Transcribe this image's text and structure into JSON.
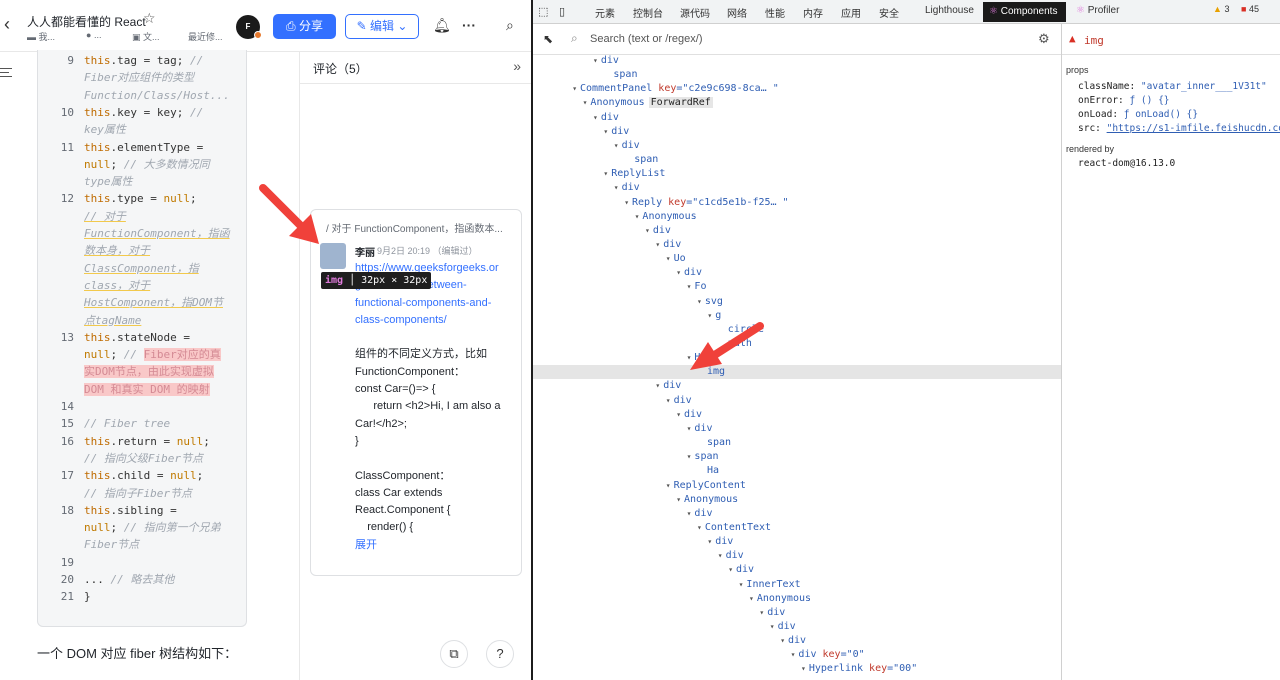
{
  "doc": {
    "title": "人人都能看懂的 React",
    "meta": [
      "我...",
      "...",
      "文...",
      "最近修..."
    ],
    "avatar_initials": "F",
    "share_label": "分享",
    "edit_label": "编辑",
    "code_lines": [
      {
        "n": "9",
        "html": "<span class='kw'>this</span>.tag = tag; <span class='cm'>//</span>"
      },
      {
        "n": "",
        "html": "<span class='cm'>Fiber对应组件的类型</span>"
      },
      {
        "n": "",
        "html": "<span class='cm'>Function/Class/Host...</span>"
      },
      {
        "n": "10",
        "html": "<span class='kw'>this</span>.key = key; <span class='cm'>//</span>"
      },
      {
        "n": "",
        "html": "<span class='cm'>key属性</span>"
      },
      {
        "n": "11",
        "html": "<span class='kw'>this</span>.elementType ="
      },
      {
        "n": "",
        "html": "<span class='kw2'>null</span>; <span class='cm'>// 大多数情况同</span>"
      },
      {
        "n": "",
        "html": "<span class='cm'>type属性</span>"
      },
      {
        "n": "12",
        "html": "<span class='kw'>this</span>.type = <span class='kw2'>null</span>;"
      },
      {
        "n": "",
        "html": "<span class='cm ul'>// 对于</span>"
      },
      {
        "n": "",
        "html": "<span class='cm ul'>FunctionComponent，指函</span>"
      },
      {
        "n": "",
        "html": "<span class='cm ul'>数本身，对于</span>"
      },
      {
        "n": "",
        "html": "<span class='cm ul'>ClassComponent，指</span>"
      },
      {
        "n": "",
        "html": "<span class='cm ul'>class，对于</span>"
      },
      {
        "n": "",
        "html": "<span class='cm ul'>HostComponent，指DOM节</span>"
      },
      {
        "n": "",
        "html": "<span class='cm ul'>点tagName</span>"
      },
      {
        "n": "13",
        "html": "<span class='kw'>this</span>.stateNode ="
      },
      {
        "n": "",
        "html": "<span class='kw2'>null</span>; <span class='cm'>//</span> <span class='hl'>Fiber对应的真</span>"
      },
      {
        "n": "",
        "html": "<span class='hl'>实DOM节点，由此实现虚拟</span>"
      },
      {
        "n": "",
        "html": "<span class='hl'>DOM 和真实 DOM 的映射</span>"
      },
      {
        "n": "14",
        "html": ""
      },
      {
        "n": "15",
        "html": "  <span class='cm'>// Fiber tree</span>"
      },
      {
        "n": "16",
        "html": "<span class='kw'>this</span>.return = <span class='kw2'>null</span>;"
      },
      {
        "n": "",
        "html": "<span class='cm'>// 指向父级Fiber节点</span>"
      },
      {
        "n": "17",
        "html": "<span class='kw'>this</span>.child = <span class='kw2'>null</span>;"
      },
      {
        "n": "",
        "html": "<span class='cm'>// 指向子Fiber节点</span>"
      },
      {
        "n": "18",
        "html": "<span class='kw'>this</span>.sibling ="
      },
      {
        "n": "",
        "html": "<span class='kw2'>null</span>;  <span class='cm'>// 指向第一个兄弟</span>"
      },
      {
        "n": "",
        "html": "<span class='cm'>Fiber节点</span>"
      },
      {
        "n": "19",
        "html": ""
      },
      {
        "n": "20",
        "html": "... <span class='cm'>// 略去其他</span>"
      },
      {
        "n": "21",
        "html": "}"
      }
    ],
    "bottom_text": "一个 DOM 对应 fiber 树结构如下："
  },
  "comments": {
    "title": "评论（5）",
    "quote": "/ 对于 FunctionComponent，指函数本...",
    "author": "李丽",
    "time": "9月2日 20:19 （编辑过）",
    "link": "https://www.geeksforgeeks.org/differences-between-functional-components-and-class-components/",
    "link_display": [
      "https://www.geeksforgeeks.or",
      "g/differences-between-",
      "functional-components-and-",
      "class-components/"
    ],
    "body": [
      "",
      "组件的不同定义方式，比如",
      "FunctionComponent：",
      "const Car=()=> {",
      "      return <h2>Hi, I am also a",
      "Car!</h2>;",
      "}",
      "",
      "ClassComponent：",
      "class Car extends",
      "React.Component {",
      "    render() {"
    ],
    "more": "展开"
  },
  "tooltip": {
    "tag": "img",
    "size": "32px × 32px"
  },
  "devtools": {
    "tabs": [
      "元素",
      "控制台",
      "源代码",
      "网络",
      "性能",
      "内存",
      "应用",
      "安全",
      "Lighthouse"
    ],
    "active_tab": "Components",
    "profiler_tab": "Profiler",
    "warnings": "3",
    "errors": "45",
    "search_placeholder": "Search (text or /regex/)",
    "selected_component": "img",
    "tree": [
      {
        "indent": 5,
        "arrow": "▾",
        "name": "div"
      },
      {
        "indent": 6,
        "arrow": "",
        "name": "span"
      },
      {
        "indent": 3,
        "arrow": "▾",
        "name": "CommentPanel",
        "key": "\"c2e9c698-8ca… \""
      },
      {
        "indent": 4,
        "arrow": "▾",
        "name": "Anonymous",
        "fwd": "ForwardRef"
      },
      {
        "indent": 5,
        "arrow": "▾",
        "name": "div"
      },
      {
        "indent": 6,
        "arrow": "▾",
        "name": "div"
      },
      {
        "indent": 7,
        "arrow": "▾",
        "name": "div"
      },
      {
        "indent": 8,
        "arrow": "",
        "name": "span"
      },
      {
        "indent": 6,
        "arrow": "▾",
        "name": "ReplyList"
      },
      {
        "indent": 7,
        "arrow": "▾",
        "name": "div"
      },
      {
        "indent": 8,
        "arrow": "▾",
        "name": "Reply",
        "key": "\"c1cd5e1b-f25… \""
      },
      {
        "indent": 9,
        "arrow": "▾",
        "name": "Anonymous"
      },
      {
        "indent": 10,
        "arrow": "▾",
        "name": "div"
      },
      {
        "indent": 11,
        "arrow": "▾",
        "name": "div"
      },
      {
        "indent": 12,
        "arrow": "▾",
        "name": "Uo"
      },
      {
        "indent": 13,
        "arrow": "▾",
        "name": "div"
      },
      {
        "indent": 14,
        "arrow": "▾",
        "name": "Fo"
      },
      {
        "indent": 15,
        "arrow": "▾",
        "name": "svg"
      },
      {
        "indent": 16,
        "arrow": "▾",
        "name": "g"
      },
      {
        "indent": 17,
        "arrow": "",
        "name": "circle"
      },
      {
        "indent": 17,
        "arrow": "",
        "name": "path"
      },
      {
        "indent": 14,
        "arrow": "▾",
        "name": "Ho"
      },
      {
        "indent": 15,
        "arrow": "",
        "name": "img",
        "selected": true
      },
      {
        "indent": 11,
        "arrow": "▾",
        "name": "div"
      },
      {
        "indent": 12,
        "arrow": "▾",
        "name": "div"
      },
      {
        "indent": 13,
        "arrow": "▾",
        "name": "div"
      },
      {
        "indent": 14,
        "arrow": "▾",
        "name": "div"
      },
      {
        "indent": 15,
        "arrow": "",
        "name": "span"
      },
      {
        "indent": 14,
        "arrow": "▾",
        "name": "span"
      },
      {
        "indent": 15,
        "arrow": "",
        "name": "Ha"
      },
      {
        "indent": 12,
        "arrow": "▾",
        "name": "ReplyContent"
      },
      {
        "indent": 13,
        "arrow": "▾",
        "name": "Anonymous"
      },
      {
        "indent": 14,
        "arrow": "▾",
        "name": "div"
      },
      {
        "indent": 15,
        "arrow": "▾",
        "name": "ContentText"
      },
      {
        "indent": 16,
        "arrow": "▾",
        "name": "div"
      },
      {
        "indent": 17,
        "arrow": "▾",
        "name": "div"
      },
      {
        "indent": 18,
        "arrow": "▾",
        "name": "div"
      },
      {
        "indent": 19,
        "arrow": "▾",
        "name": "InnerText"
      },
      {
        "indent": 20,
        "arrow": "▾",
        "name": "Anonymous"
      },
      {
        "indent": 21,
        "arrow": "▾",
        "name": "div"
      },
      {
        "indent": 22,
        "arrow": "▾",
        "name": "div"
      },
      {
        "indent": 23,
        "arrow": "▾",
        "name": "div"
      },
      {
        "indent": 24,
        "arrow": "▾",
        "name": "div",
        "key": "\"0\""
      },
      {
        "indent": 25,
        "arrow": "▾",
        "name": "Hyperlink",
        "key": "\"00\""
      }
    ],
    "props_label": "props",
    "props": [
      {
        "k": "className:",
        "v": "\"avatar_inner___1V31t\""
      },
      {
        "k": "onError:",
        "v": "ƒ () {}"
      },
      {
        "k": "onLoad:",
        "v": "ƒ onLoad() {}"
      },
      {
        "k": "src:",
        "v": "\"https://s1-imfile.feishucdn.com/"
      }
    ],
    "rendered_by_label": "rendered by",
    "rendered_by": "react-dom@16.13.0"
  },
  "colors": {
    "accent": "#3370ff",
    "arrow": "#f0413a",
    "devtools_active": "#1a1a1a"
  }
}
